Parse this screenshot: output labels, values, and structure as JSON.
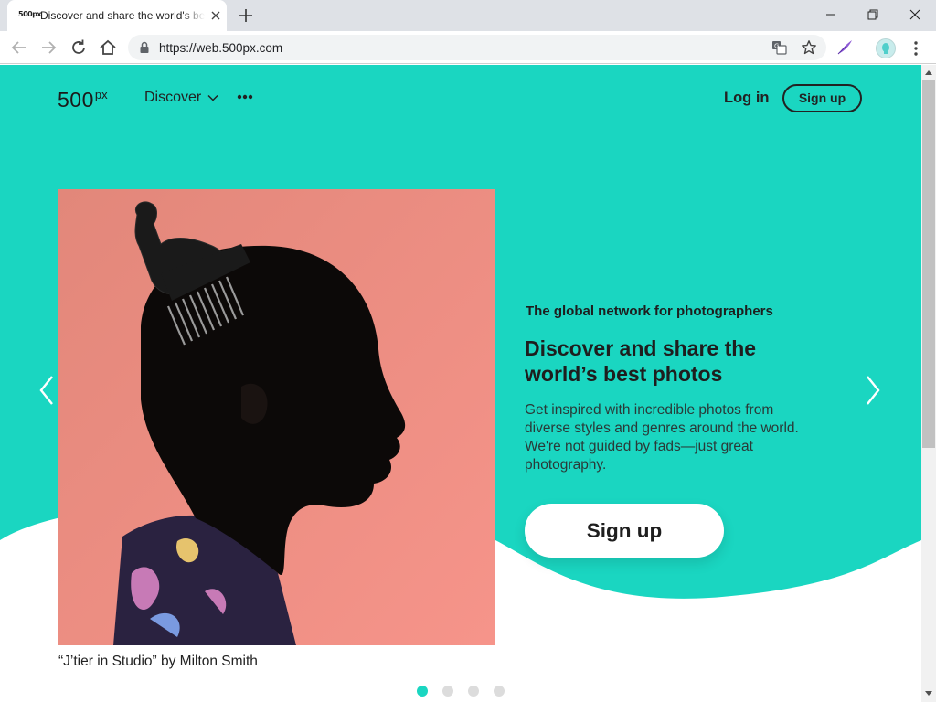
{
  "browser": {
    "tab_title": "Discover and share the world's best photos",
    "tab_favicon": "500px",
    "url": "https://web.500px.com",
    "icons": [
      "back-arrow-icon",
      "forward-arrow-icon",
      "reload-icon",
      "home-icon",
      "lock-icon",
      "translate-icon",
      "star-icon",
      "feather-extension-icon",
      "profile-avatar-icon",
      "kebab-menu-icon"
    ]
  },
  "site_nav": {
    "logo_main": "500",
    "logo_px": "px",
    "discover_label": "Discover",
    "more_label": "•••",
    "login_label": "Log in",
    "signup_label": "Sign up"
  },
  "hero": {
    "eyebrow": "The global network for photographers",
    "headline": "Discover and share the world’s best photos",
    "body": "Get inspired with incredible photos from diverse styles and genres around the world. We're not guided by fads—just great photography.",
    "cta_label": "Sign up",
    "photo_caption": "“J’tier in Studio” by Milton Smith"
  },
  "carousel": {
    "dot_count": 4,
    "active_index": 0
  },
  "colors": {
    "accent": "#1ad6c1",
    "photo_background": "#f0807a",
    "text_dark": "#1e1e1e"
  }
}
